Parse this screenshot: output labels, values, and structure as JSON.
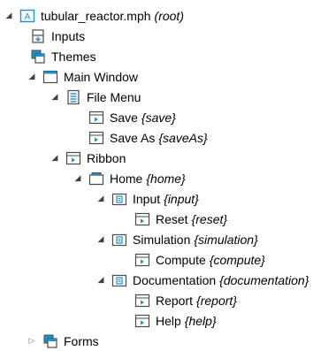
{
  "colors": {
    "accent": "#1e90c8",
    "icon_fill": "#ffffff",
    "icon_stroke": "#4a4a4a"
  },
  "tree": {
    "root": {
      "label": "tubular_reactor.mph",
      "tag": "(root)",
      "icon": "app-icon"
    },
    "inputs": {
      "label": "Inputs",
      "icon": "inputs-icon"
    },
    "themes": {
      "label": "Themes",
      "icon": "themes-icon"
    },
    "main_window": {
      "label": "Main Window",
      "icon": "window-icon"
    },
    "file_menu": {
      "label": "File Menu",
      "icon": "menu-icon"
    },
    "save": {
      "label": "Save",
      "tag": "{save}",
      "icon": "command-icon"
    },
    "save_as": {
      "label": "Save As",
      "tag": "{saveAs}",
      "icon": "command-icon"
    },
    "ribbon": {
      "label": "Ribbon",
      "icon": "ribbon-icon"
    },
    "home": {
      "label": "Home",
      "tag": "{home}",
      "icon": "folder-tab-icon"
    },
    "input": {
      "label": "Input",
      "tag": "{input}",
      "icon": "section-icon"
    },
    "reset": {
      "label": "Reset",
      "tag": "{reset}",
      "icon": "command-icon"
    },
    "simulation": {
      "label": "Simulation",
      "tag": "{simulation}",
      "icon": "section-icon"
    },
    "compute": {
      "label": "Compute",
      "tag": "{compute}",
      "icon": "command-icon"
    },
    "documentation": {
      "label": "Documentation",
      "tag": "{documentation}",
      "icon": "section-icon"
    },
    "report": {
      "label": "Report",
      "tag": "{report}",
      "icon": "command-icon"
    },
    "help": {
      "label": "Help",
      "tag": "{help}",
      "icon": "command-icon"
    },
    "forms": {
      "label": "Forms",
      "icon": "forms-icon"
    }
  }
}
